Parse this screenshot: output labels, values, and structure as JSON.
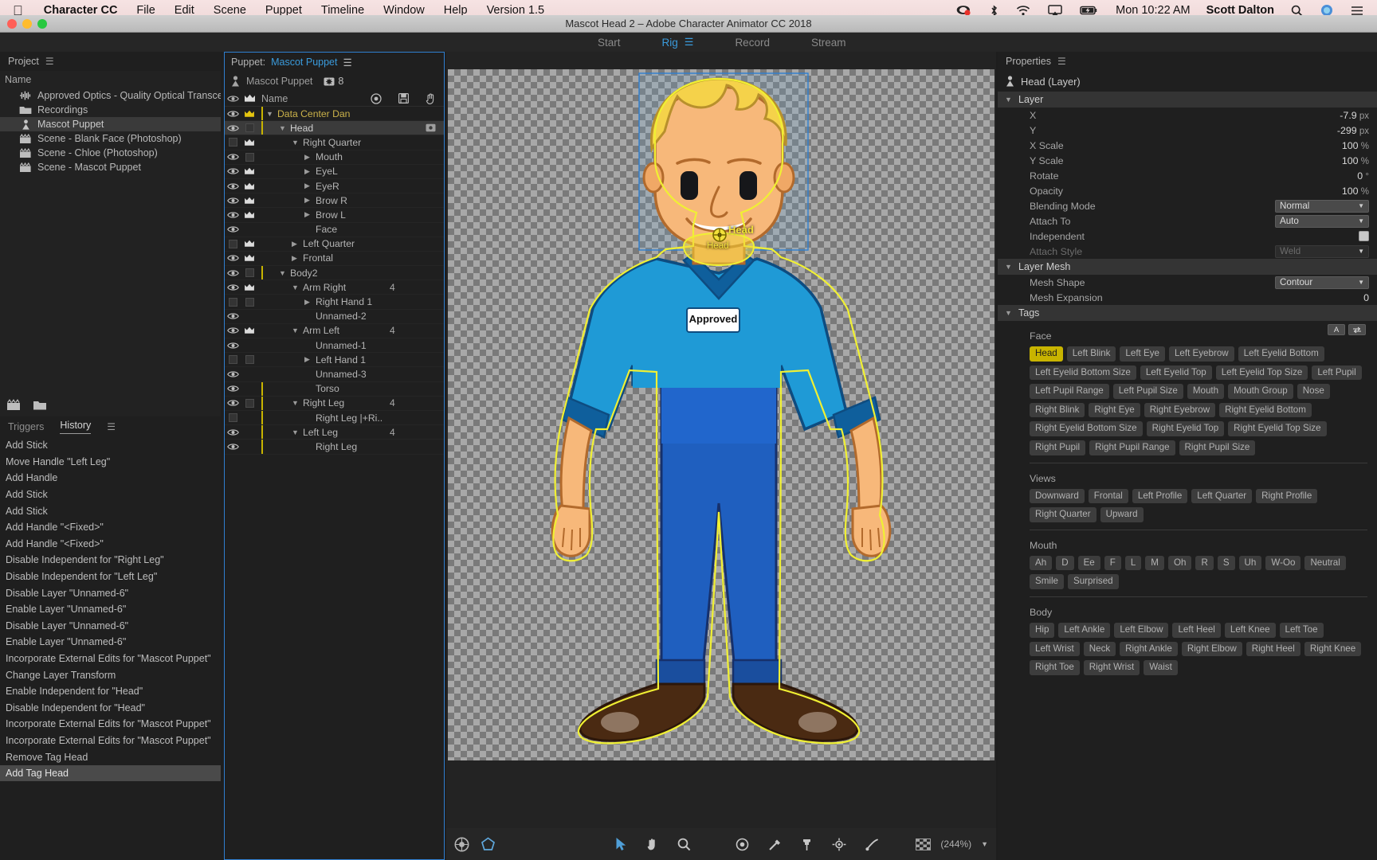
{
  "macbar": {
    "apple_icon": "apple-logo-icon",
    "app_name": "Character CC",
    "menus": [
      "File",
      "Edit",
      "Scene",
      "Puppet",
      "Timeline",
      "Window",
      "Help",
      "Version 1.5"
    ],
    "status_icons": [
      "screen-record-icon",
      "bluetooth-icon",
      "wifi-icon",
      "airplay-icon",
      "battery-charging-icon"
    ],
    "clock": "Mon 10:22 AM",
    "user": "Scott Dalton",
    "right_icons": [
      "search-icon",
      "siri-icon",
      "control-center-icon"
    ]
  },
  "window": {
    "title": "Mascot Head 2 – Adobe Character Animator CC 2018",
    "traffic": {
      "close": "#ff5f57",
      "minimize": "#febc2e",
      "zoom": "#28c840"
    }
  },
  "workspace_tabs": {
    "items": [
      "Start",
      "Rig",
      "Record",
      "Stream"
    ],
    "active": "Rig",
    "menu_icon": "hamburger-icon"
  },
  "project_panel": {
    "title": "Project",
    "menu_icon": "hamburger-icon",
    "column_header": "Name",
    "items": [
      {
        "label": "Approved Optics - Quality Optical Transceivers ...",
        "icon": "audio-waveform-icon",
        "selected": false
      },
      {
        "label": "Recordings",
        "icon": "folder-icon",
        "selected": false
      },
      {
        "label": "Mascot Puppet",
        "icon": "puppet-icon",
        "selected": true
      },
      {
        "label": "Scene - Blank Face (Photoshop)",
        "icon": "scene-clapper-icon",
        "selected": false
      },
      {
        "label": "Scene - Chloe (Photoshop)",
        "icon": "scene-clapper-icon",
        "selected": false
      },
      {
        "label": "Scene - Mascot Puppet",
        "icon": "scene-clapper-icon",
        "selected": false
      }
    ],
    "toolbar_icons": [
      "new-scene-icon",
      "new-folder-icon"
    ]
  },
  "history_panel": {
    "tabs": [
      {
        "label": "Triggers",
        "active": false
      },
      {
        "label": "History",
        "active": true
      }
    ],
    "menu_icon": "hamburger-icon",
    "entries": [
      {
        "label": "Add Stick",
        "selected": false
      },
      {
        "label": "Move Handle \"Left Leg\"",
        "selected": false
      },
      {
        "label": "Add Handle",
        "selected": false
      },
      {
        "label": "Add Stick",
        "selected": false
      },
      {
        "label": "Add Stick",
        "selected": false
      },
      {
        "label": "Add Handle \"<Fixed>\"",
        "selected": false
      },
      {
        "label": "Add Handle \"<Fixed>\"",
        "selected": false
      },
      {
        "label": "Disable Independent for \"Right Leg\"",
        "selected": false
      },
      {
        "label": "Disable Independent for \"Left Leg\"",
        "selected": false
      },
      {
        "label": "Disable Layer \"Unnamed-6\"",
        "selected": false
      },
      {
        "label": "Enable Layer \"Unnamed-6\"",
        "selected": false
      },
      {
        "label": "Disable Layer \"Unnamed-6\"",
        "selected": false
      },
      {
        "label": "Enable Layer \"Unnamed-6\"",
        "selected": false
      },
      {
        "label": "Incorporate External Edits for \"Mascot Puppet\"",
        "selected": false
      },
      {
        "label": "Change Layer Transform",
        "selected": false
      },
      {
        "label": "Enable Independent for \"Head\"",
        "selected": false
      },
      {
        "label": "Disable Independent for \"Head\"",
        "selected": false
      },
      {
        "label": "Incorporate External Edits for \"Mascot Puppet\"",
        "selected": false
      },
      {
        "label": "Incorporate External Edits for \"Mascot Puppet\"",
        "selected": false
      },
      {
        "label": "Remove Tag Head",
        "selected": false
      },
      {
        "label": "Add Tag Head",
        "selected": true
      }
    ]
  },
  "puppet_panel": {
    "title_prefix": "Puppet:",
    "title_name": "Mascot Puppet",
    "menu_icon": "hamburger-icon",
    "root_label": "Mascot Puppet",
    "root_icon": "puppet-icon",
    "root_badge_icon": "tag-badge-icon",
    "root_badge_count": "8",
    "columns": {
      "eye": "visibility-column",
      "crown": "crown-column",
      "name": "Name",
      "icons": [
        "target-icon",
        "save-icon",
        "hand-icon"
      ]
    },
    "layers": [
      {
        "name": "Data Center Dan",
        "indent": 0,
        "eye": true,
        "crown": "gold",
        "twisty": "down",
        "num": "",
        "selected": false,
        "highlight": true,
        "ybar": true
      },
      {
        "name": "Head",
        "indent": 1,
        "eye": true,
        "crown": "box",
        "twisty": "down",
        "num": "",
        "selected": true,
        "highlight": false,
        "ybar": true,
        "tagicon": true
      },
      {
        "name": "Right Quarter",
        "indent": 2,
        "eye": false,
        "crown": "white",
        "twisty": "down",
        "num": "",
        "selected": false,
        "highlight": false,
        "ybar": false
      },
      {
        "name": "Mouth",
        "indent": 3,
        "eye": true,
        "crown": "box",
        "twisty": "right",
        "num": "",
        "selected": false,
        "highlight": false,
        "ybar": false
      },
      {
        "name": "EyeL",
        "indent": 3,
        "eye": true,
        "crown": "white",
        "twisty": "right",
        "num": "",
        "selected": false,
        "highlight": false,
        "ybar": false
      },
      {
        "name": "EyeR",
        "indent": 3,
        "eye": true,
        "crown": "white",
        "twisty": "right",
        "num": "",
        "selected": false,
        "highlight": false,
        "ybar": false
      },
      {
        "name": "Brow R",
        "indent": 3,
        "eye": true,
        "crown": "white",
        "twisty": "right",
        "num": "",
        "selected": false,
        "highlight": false,
        "ybar": false
      },
      {
        "name": "Brow L",
        "indent": 3,
        "eye": true,
        "crown": "white",
        "twisty": "right",
        "num": "",
        "selected": false,
        "highlight": false,
        "ybar": false
      },
      {
        "name": "Face",
        "indent": 3,
        "eye": true,
        "crown": "none",
        "twisty": "none",
        "num": "",
        "selected": false,
        "highlight": false,
        "ybar": false
      },
      {
        "name": "Left Quarter",
        "indent": 2,
        "eye": false,
        "crown": "white",
        "twisty": "right",
        "num": "",
        "selected": false,
        "highlight": false,
        "ybar": false
      },
      {
        "name": "Frontal",
        "indent": 2,
        "eye": true,
        "crown": "white",
        "twisty": "right",
        "num": "",
        "selected": false,
        "highlight": false,
        "ybar": false
      },
      {
        "name": "Body2",
        "indent": 1,
        "eye": true,
        "crown": "box",
        "twisty": "down",
        "num": "",
        "selected": false,
        "highlight": false,
        "ybar": true
      },
      {
        "name": "Arm Right",
        "indent": 2,
        "eye": true,
        "crown": "white",
        "twisty": "down",
        "num": "4",
        "selected": false,
        "highlight": false,
        "ybar": false
      },
      {
        "name": "Right Hand 1",
        "indent": 3,
        "eye": false,
        "crown": "box",
        "twisty": "right",
        "num": "",
        "selected": false,
        "highlight": false,
        "ybar": false
      },
      {
        "name": "Unnamed-2",
        "indent": 3,
        "eye": true,
        "crown": "none",
        "twisty": "none",
        "num": "",
        "selected": false,
        "highlight": false,
        "ybar": false
      },
      {
        "name": "Arm Left",
        "indent": 2,
        "eye": true,
        "crown": "white",
        "twisty": "down",
        "num": "4",
        "selected": false,
        "highlight": false,
        "ybar": false
      },
      {
        "name": "Unnamed-1",
        "indent": 3,
        "eye": true,
        "crown": "none",
        "twisty": "none",
        "num": "",
        "selected": false,
        "highlight": false,
        "ybar": false
      },
      {
        "name": "Left Hand 1",
        "indent": 3,
        "eye": false,
        "crown": "box",
        "twisty": "right",
        "num": "",
        "selected": false,
        "highlight": false,
        "ybar": false
      },
      {
        "name": "Unnamed-3",
        "indent": 3,
        "eye": true,
        "crown": "none",
        "twisty": "none",
        "num": "",
        "selected": false,
        "highlight": false,
        "ybar": false
      },
      {
        "name": "Torso",
        "indent": 3,
        "eye": true,
        "crown": "none",
        "twisty": "none",
        "num": "",
        "selected": false,
        "highlight": false,
        "ybar": true
      },
      {
        "name": "Right Leg",
        "indent": 2,
        "eye": true,
        "crown": "box",
        "twisty": "down",
        "num": "4",
        "selected": false,
        "highlight": false,
        "ybar": true
      },
      {
        "name": "Right Leg  |+Ri..",
        "indent": 3,
        "eye": false,
        "crown": "none",
        "twisty": "none",
        "num": "",
        "selected": false,
        "highlight": false,
        "ybar": true
      },
      {
        "name": "Left Leg",
        "indent": 2,
        "eye": true,
        "crown": "none",
        "twisty": "down",
        "num": "4",
        "selected": false,
        "highlight": false,
        "ybar": true
      },
      {
        "name": "Right Leg",
        "indent": 3,
        "eye": true,
        "crown": "none",
        "twisty": "none",
        "num": "",
        "selected": false,
        "highlight": false,
        "ybar": true
      }
    ]
  },
  "canvas": {
    "handle_label": "Head",
    "handle_sublabel": "Head",
    "zoom_level": "(244%)",
    "left_tools": [
      "color-swatch-icon",
      "shape-outline-icon"
    ],
    "center_tools": [
      "select-arrow-icon",
      "hand-tool-icon",
      "zoom-tool-icon",
      "handle-tool-icon",
      "stick-tool-icon",
      "pin-tool-icon",
      "dangle-tool-icon",
      "draggable-tool-icon"
    ],
    "right_tools": [
      "transparency-grid-icon",
      "zoom-dropdown-icon"
    ]
  },
  "properties": {
    "title": "Properties",
    "menu_icon": "hamburger-icon",
    "object_icon": "puppet-icon",
    "object_name": "Head (Layer)",
    "sections": {
      "layer": {
        "label": "Layer",
        "rows": [
          {
            "label": "X",
            "value": "-7.9",
            "unit": "px",
            "kind": "number"
          },
          {
            "label": "Y",
            "value": "-299",
            "unit": "px",
            "kind": "number"
          },
          {
            "label": "X Scale",
            "value": "100",
            "unit": "%",
            "kind": "number"
          },
          {
            "label": "Y Scale",
            "value": "100",
            "unit": "%",
            "kind": "number"
          },
          {
            "label": "Rotate",
            "value": "0",
            "unit": "°",
            "kind": "number"
          },
          {
            "label": "Opacity",
            "value": "100",
            "unit": "%",
            "kind": "number"
          },
          {
            "label": "Blending Mode",
            "value": "Normal",
            "unit": "",
            "kind": "select"
          },
          {
            "label": "Attach To",
            "value": "Auto",
            "unit": "",
            "kind": "select"
          },
          {
            "label": "Independent",
            "value": "",
            "unit": "",
            "kind": "checkbox"
          },
          {
            "label": "Attach Style",
            "value": "Weld",
            "unit": "",
            "kind": "select-dim",
            "disabled": true
          }
        ]
      },
      "layer_mesh": {
        "label": "Layer Mesh",
        "rows": [
          {
            "label": "Mesh Shape",
            "value": "Contour",
            "unit": "",
            "kind": "select"
          },
          {
            "label": "Mesh Expansion",
            "value": "0",
            "unit": "",
            "kind": "number"
          }
        ]
      },
      "tags": {
        "label": "Tags",
        "ab_buttons": [
          "A",
          "ab-swap-icon"
        ],
        "groups": [
          {
            "name": "Face",
            "tags": [
              {
                "label": "Head",
                "on": true
              },
              {
                "label": "Left Blink"
              },
              {
                "label": "Left Eye"
              },
              {
                "label": "Left Eyebrow"
              },
              {
                "label": "Left Eyelid Bottom"
              },
              {
                "label": "Left Eyelid Bottom Size"
              },
              {
                "label": "Left Eyelid Top"
              },
              {
                "label": "Left Eyelid Top Size"
              },
              {
                "label": "Left Pupil"
              },
              {
                "label": "Left Pupil Range"
              },
              {
                "label": "Left Pupil Size"
              },
              {
                "label": "Mouth"
              },
              {
                "label": "Mouth Group"
              },
              {
                "label": "Nose"
              },
              {
                "label": "Right Blink"
              },
              {
                "label": "Right Eye"
              },
              {
                "label": "Right Eyebrow"
              },
              {
                "label": "Right Eyelid Bottom"
              },
              {
                "label": "Right Eyelid Bottom Size"
              },
              {
                "label": "Right Eyelid Top"
              },
              {
                "label": "Right Eyelid Top Size"
              },
              {
                "label": "Right Pupil"
              },
              {
                "label": "Right Pupil Range"
              },
              {
                "label": "Right Pupil Size"
              }
            ]
          },
          {
            "name": "Views",
            "tags": [
              {
                "label": "Downward"
              },
              {
                "label": "Frontal"
              },
              {
                "label": "Left Profile"
              },
              {
                "label": "Left Quarter"
              },
              {
                "label": "Right Profile"
              },
              {
                "label": "Right Quarter"
              },
              {
                "label": "Upward"
              }
            ]
          },
          {
            "name": "Mouth",
            "tags": [
              {
                "label": "Ah"
              },
              {
                "label": "D"
              },
              {
                "label": "Ee"
              },
              {
                "label": "F"
              },
              {
                "label": "L"
              },
              {
                "label": "M"
              },
              {
                "label": "Oh"
              },
              {
                "label": "R"
              },
              {
                "label": "S"
              },
              {
                "label": "Uh"
              },
              {
                "label": "W-Oo"
              },
              {
                "label": "Neutral"
              },
              {
                "label": "Smile"
              },
              {
                "label": "Surprised"
              }
            ]
          },
          {
            "name": "Body",
            "tags": [
              {
                "label": "Hip"
              },
              {
                "label": "Left Ankle"
              },
              {
                "label": "Left Elbow"
              },
              {
                "label": "Left Heel"
              },
              {
                "label": "Left Knee"
              },
              {
                "label": "Left Toe"
              },
              {
                "label": "Left Wrist"
              },
              {
                "label": "Neck"
              },
              {
                "label": "Right Ankle"
              },
              {
                "label": "Right Elbow"
              },
              {
                "label": "Right Heel"
              },
              {
                "label": "Right Knee"
              },
              {
                "label": "Right Toe"
              },
              {
                "label": "Right Wrist"
              },
              {
                "label": "Waist"
              }
            ]
          }
        ]
      }
    }
  },
  "colors": {
    "accent_blue": "#3a9bdc",
    "tag_active": "#c8b400",
    "panel_bg": "#1f1f1f",
    "selection": "#3b3b3b",
    "shirt": "#1f9ad6",
    "hair": "#f5d24a",
    "skin": "#f7b87a",
    "pants": "#1f5fbf"
  }
}
